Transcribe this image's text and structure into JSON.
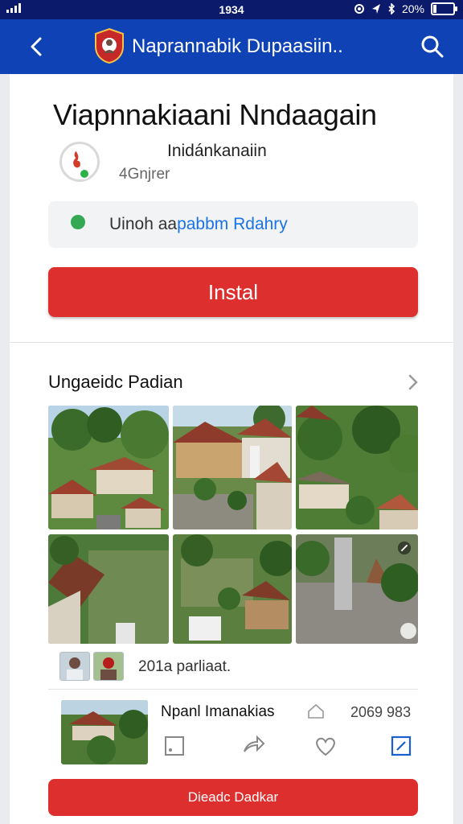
{
  "status_bar": {
    "time": "1934",
    "battery": "20%",
    "battery_level": 0.2
  },
  "app_bar": {
    "title": "Naprannabik Dupaasiin..",
    "back_icon": "back-arrow-icon",
    "search_icon": "search-icon"
  },
  "app": {
    "name": "Viapnnakiaani Nndaagain",
    "developer": "Inidánkanaiin",
    "meta": "4Gnjrer",
    "notice": {
      "text_before": "Uinoh aa",
      "text_link": "pabbm Rdahry"
    },
    "install_label": "Instal"
  },
  "screenshots": {
    "title": "Ungaeidc Padian",
    "people_text": "201a parliaat."
  },
  "review": {
    "name": "Npanl Imanakias",
    "count": "2069 983"
  },
  "bottom_button": {
    "label": "Dieadc Dadkar"
  },
  "colors": {
    "appbar": "#0f43b5",
    "accent_red": "#de2f2f",
    "link_blue": "#1a73e8"
  }
}
